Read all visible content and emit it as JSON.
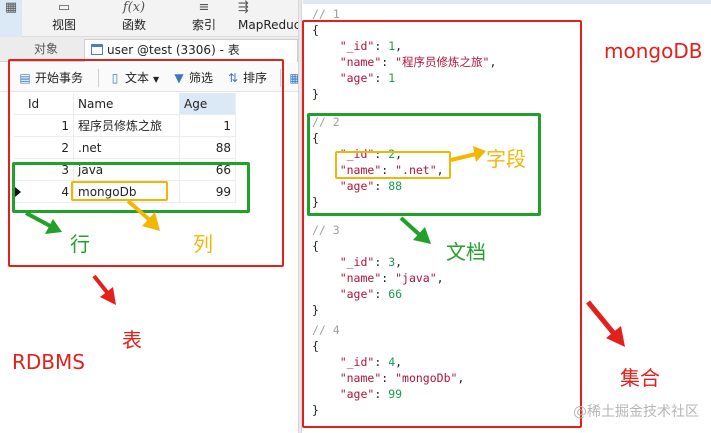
{
  "app": {
    "ribbon": [
      {
        "label": "",
        "icon": "table-icon"
      },
      {
        "label": "视图",
        "icon": "view-icon"
      },
      {
        "label": "函数",
        "icon": "function-icon"
      },
      {
        "label": "索引",
        "icon": "index-icon"
      },
      {
        "label": "MapReduce",
        "icon": "mapreduce-icon"
      }
    ],
    "ribbon_function_glyph": "f(x)",
    "tabs": {
      "objects_label": "对象",
      "active_tab_label": "user @test (3306) - 表"
    },
    "toolbar": {
      "begin_transaction": "开始事务",
      "text": "文本",
      "filter": "筛选",
      "sort": "排序"
    }
  },
  "rdbms_table": {
    "columns": [
      "Id",
      "Name",
      "Age"
    ],
    "rows": [
      {
        "id": "1",
        "name": "程序员修炼之旅",
        "age": "1"
      },
      {
        "id": "2",
        "name": ".net",
        "age": "88"
      },
      {
        "id": "3",
        "name": "java",
        "age": "66"
      },
      {
        "id": "4",
        "name": "mongoDb",
        "age": "99"
      }
    ]
  },
  "mongo_documents": [
    {
      "comment": "// 1",
      "id_value": "1",
      "name_value": "\"程序员修炼之旅\"",
      "age_value": "1"
    },
    {
      "comment": "// 2",
      "id_value": "2",
      "name_value": "\".net\"",
      "age_value": "88"
    },
    {
      "comment": "// 3",
      "id_value": "3",
      "name_value": "\"java\"",
      "age_value": "66"
    },
    {
      "comment": "// 4",
      "id_value": "4",
      "name_value": "\"mongoDb\"",
      "age_value": "99"
    }
  ],
  "mongo_keys": {
    "id": "\"_id\"",
    "name": "\"name\"",
    "age": "\"age\""
  },
  "annotations": {
    "row": "行",
    "column": "列",
    "table": "表",
    "rdbms": "RDBMS",
    "mongodb": "mongoDB",
    "field": "字段",
    "document": "文档",
    "collection": "集合"
  },
  "colors": {
    "red": "#e3201b",
    "green": "#22a12a",
    "yellow": "#f2b705",
    "mongo_key": "#b0143a",
    "mongo_number": "#1a9a52"
  },
  "watermark": "@稀土掘金技术社区"
}
